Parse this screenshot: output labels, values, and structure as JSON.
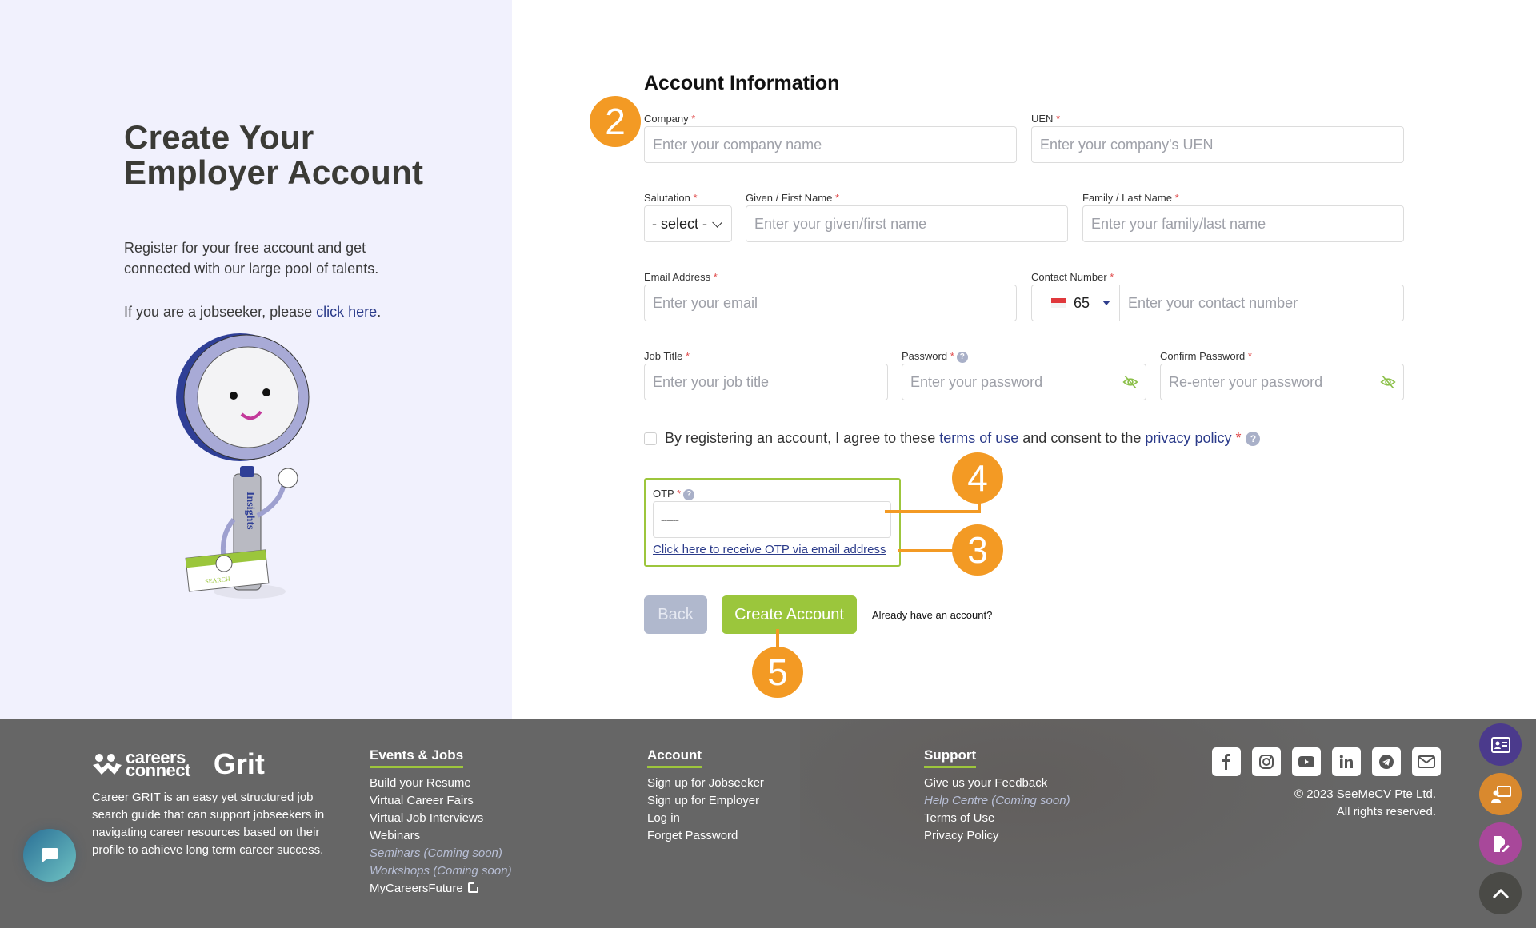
{
  "hero": {
    "title": "Create Your Employer Account",
    "description": "Register for your free account and get connected with our large pool of talents.",
    "jobseeker_prefix": "If you are a jobseeker, please ",
    "jobseeker_link": "click here",
    "jobseeker_suffix": ".",
    "mascot_label": "Insights",
    "mascot_search": "SEARCH"
  },
  "form": {
    "section_title": "Account Information",
    "required_mark": "*",
    "help_glyph": "?",
    "company": {
      "label": "Company",
      "placeholder": "Enter your company name",
      "value": ""
    },
    "uen": {
      "label": "UEN",
      "placeholder": "Enter your company's UEN",
      "value": ""
    },
    "salutation": {
      "label": "Salutation",
      "selected": "- select -"
    },
    "first_name": {
      "label": "Given / First Name",
      "placeholder": "Enter your given/first name",
      "value": ""
    },
    "last_name": {
      "label": "Family / Last Name",
      "placeholder": "Enter your family/last name",
      "value": ""
    },
    "email": {
      "label": "Email Address",
      "placeholder": "Enter your email",
      "value": ""
    },
    "contact": {
      "label": "Contact Number",
      "country_code": "65",
      "country": "Singapore",
      "placeholder": "Enter your contact number",
      "value": ""
    },
    "job_title": {
      "label": "Job Title",
      "placeholder": "Enter your job title",
      "value": ""
    },
    "password": {
      "label": "Password",
      "placeholder": "Enter your password",
      "value": ""
    },
    "confirm_password": {
      "label": "Confirm Password",
      "placeholder": "Re-enter your password",
      "value": ""
    },
    "agreement": {
      "checked": false,
      "prefix": "By registering an account, I agree to these ",
      "terms_link": "terms of use",
      "middle": " and consent to the ",
      "privacy_link": "privacy policy"
    },
    "otp": {
      "label": "OTP",
      "placeholder": "------",
      "value": "",
      "link": "Click here to receive OTP via email address"
    },
    "buttons": {
      "back": "Back",
      "create": "Create Account"
    },
    "already_account": "Already have an account?"
  },
  "annotations": {
    "badges": [
      "2",
      "4",
      "3",
      "5"
    ],
    "color": "#f39a24"
  },
  "footer": {
    "logo_careers": "careers",
    "logo_connect": "connect",
    "logo_grit": "Grit",
    "about": "Career GRIT is an easy yet structured job search guide that can support jobseekers in navigating career resources based on their profile to achieve long term career success.",
    "columns": [
      {
        "title": "Events & Jobs",
        "items": [
          {
            "label": "Build your Resume",
            "soon": false
          },
          {
            "label": "Virtual Career Fairs",
            "soon": false
          },
          {
            "label": "Virtual Job Interviews",
            "soon": false
          },
          {
            "label": "Webinars",
            "soon": false
          },
          {
            "label": "Seminars (Coming soon)",
            "soon": true
          },
          {
            "label": "Workshops (Coming soon)",
            "soon": true
          },
          {
            "label": "MyCareersFuture",
            "soon": false,
            "external": true
          }
        ]
      },
      {
        "title": "Account",
        "items": [
          {
            "label": "Sign up for Jobseeker",
            "soon": false
          },
          {
            "label": "Sign up for Employer",
            "soon": false
          },
          {
            "label": "Log in",
            "soon": false
          },
          {
            "label": "Forget Password",
            "soon": false
          }
        ]
      },
      {
        "title": "Support",
        "items": [
          {
            "label": "Give us your Feedback",
            "soon": false
          },
          {
            "label": "Help Centre (Coming soon)",
            "soon": true
          },
          {
            "label": "Terms of Use",
            "soon": false
          },
          {
            "label": "Privacy Policy",
            "soon": false
          }
        ]
      }
    ],
    "socials": [
      "facebook-icon",
      "instagram-icon",
      "youtube-icon",
      "linkedin-icon",
      "telegram-icon",
      "email-icon"
    ],
    "copyright_line1": "© 2023 SeeMeCV Pte Ltd.",
    "copyright_line2": "All rights reserved."
  },
  "floating_buttons": [
    {
      "icon": "id-card-icon",
      "color": "#4b3a8c"
    },
    {
      "icon": "presentation-icon",
      "color": "#d9892e"
    },
    {
      "icon": "edit-document-icon",
      "color": "#a8489a"
    },
    {
      "icon": "chevron-up-icon",
      "color": "#4a4a46"
    }
  ],
  "colors": {
    "accent_green": "#9bc63c",
    "link_blue": "#2b3b8a",
    "left_panel_bg": "#f1f1fd",
    "footer_bg": "#666666",
    "required_red": "#e04a4a"
  }
}
